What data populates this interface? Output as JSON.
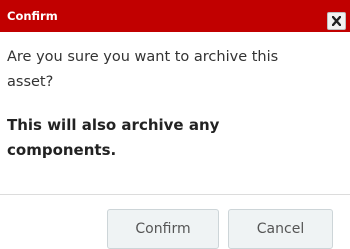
{
  "dialog": {
    "title": "Confirm",
    "close_icon": "close-x-icon",
    "message": "Are you sure you want to archive this asset?",
    "warning": "This will also archive any components.",
    "buttons": {
      "confirm_label": "Confirm",
      "cancel_label": "Cancel"
    }
  },
  "colors": {
    "titlebar": "#c10000",
    "title_text": "#ffffff",
    "button_bg": "#eff3f4"
  }
}
